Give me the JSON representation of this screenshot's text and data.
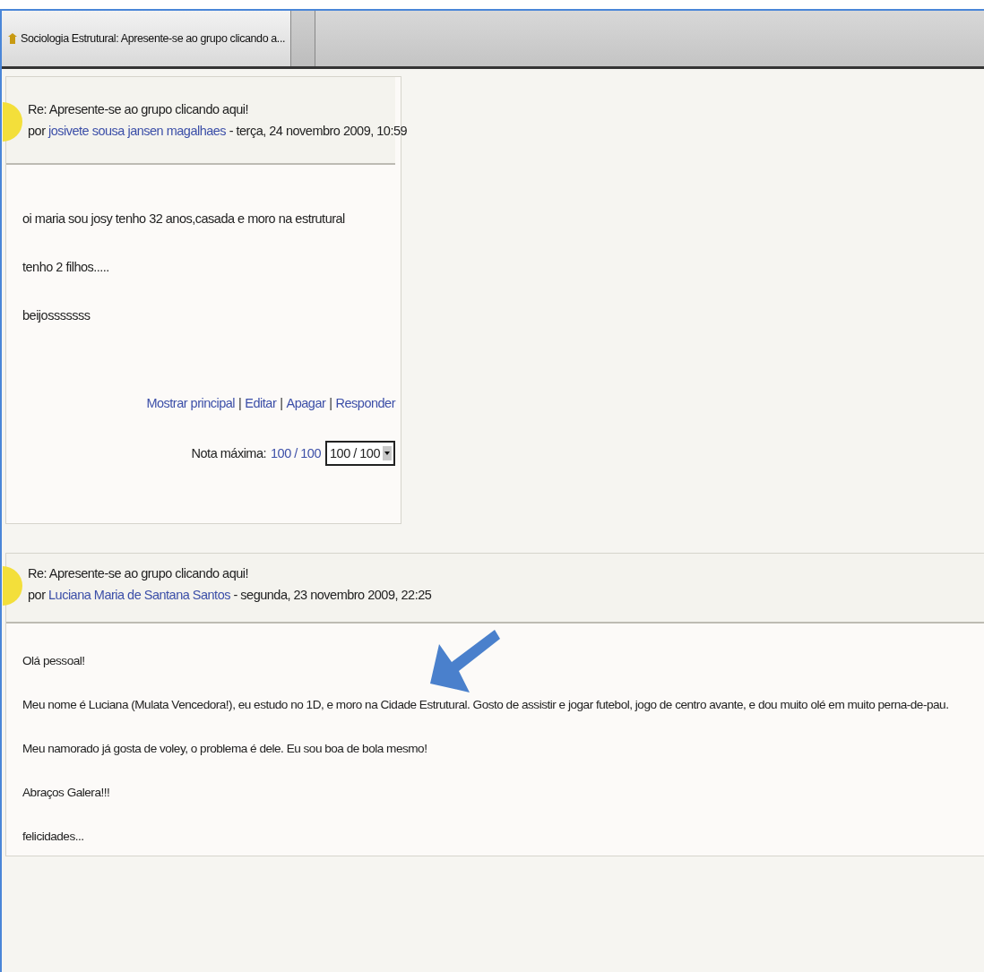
{
  "tabs": [
    {
      "label": "Sociologia Estrutural: Apresente-se ao grupo clicando a...",
      "selected": true
    },
    {
      "selected": false
    }
  ],
  "posts": [
    {
      "subject": "Re: Apresente-se ao grupo clicando aqui!",
      "by": "por",
      "author": "josivete sousa jansen magalhaes",
      "date": "- terça, 24 novembro 2009, 10:59",
      "full_width": false,
      "paragraphs": [
        "oi maria sou josy tenho 32 anos,casada e moro na estrutural",
        "tenho 2 filhos.....",
        "beijosssssss"
      ],
      "commands": [
        "Mostrar principal",
        "Editar",
        "Apagar",
        "Responder"
      ],
      "separator": "|",
      "grade": {
        "label": "Nota máxima:",
        "link": "100 / 100",
        "value": "100 / 100"
      }
    },
    {
      "subject": "Re: Apresente-se ao grupo clicando aqui!",
      "by": "por",
      "author": "Luciana Maria de Santana Santos",
      "date": "- segunda, 23 novembro 2009, 22:25",
      "full_width": true,
      "paragraphs": [
        "Olá pessoal!",
        "Meu nome é Luciana (Mulata Vencedora!), eu estudo no 1D, e moro na Cidade Estrutural. Gosto de assistir e jogar futebol, jogo de centro avante, e dou muito olé em muito perna-de-pau.",
        "Meu namorado já gosta de voley, o problema é dele. Eu sou boa de bola mesmo!",
        "Abraços Galera!!!",
        "felicidades..."
      ]
    }
  ]
}
